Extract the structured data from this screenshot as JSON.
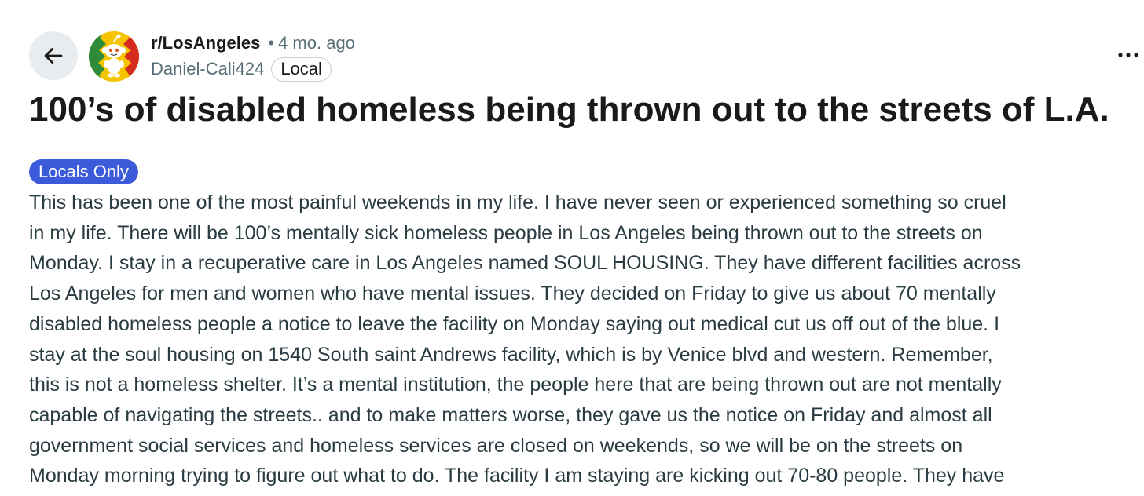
{
  "header": {
    "back_icon": "arrow-left-icon",
    "subreddit_icon": "snoo-avatar-icon",
    "subreddit": "r/LosAngeles",
    "separator": "•",
    "age": "4 mo. ago",
    "author": "Daniel-Cali424",
    "author_flair": "Local",
    "menu_icon": "more-horizontal-icon"
  },
  "post": {
    "title": "100’s of disabled homeless being thrown out to the streets of L.A.",
    "flair": "Locals Only",
    "flair_color": "#3b5bdb",
    "body_lines": [
      "This has been one of the most painful weekends in my life. I have never seen or experienced something so cruel",
      "in my life. There will be 100’s mentally sick homeless people in Los Angeles being thrown out to the streets on",
      "Monday. I stay in a recuperative care in Los Angeles named SOUL HOUSING. They have different facilities across",
      "Los Angeles for men and women who have mental issues. They decided on Friday to give us about 70 mentally",
      "disabled homeless people a notice to leave the facility on Monday saying out medical cut us off out of the blue. I",
      "stay at the soul housing on 1540 South saint Andrews facility, which is by Venice blvd and western. Remember,",
      "this is not a homeless shelter. It’s a mental institution, the people here that are being thrown out are not mentally",
      "capable of navigating the streets.. and to make matters worse, they gave us the notice on Friday and almost all",
      "government social services and homeless services are closed on weekends, so we will be on the streets on",
      "Monday morning trying to figure out what to do. The facility I am staying are kicking out 70-80 people. They have"
    ]
  }
}
